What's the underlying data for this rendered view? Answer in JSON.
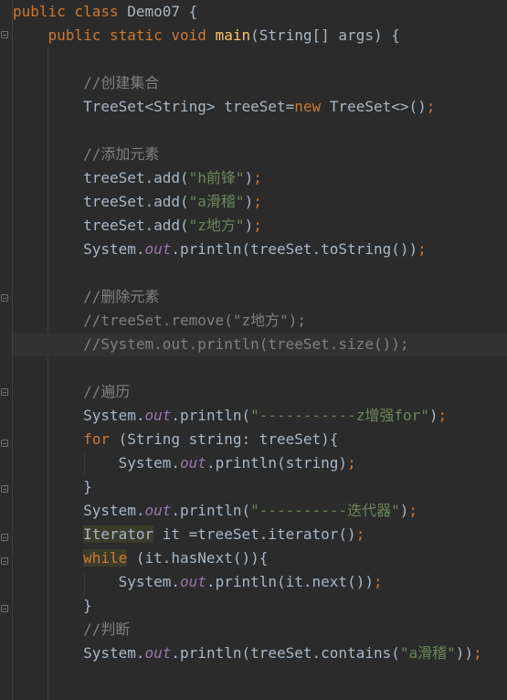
{
  "editor": {
    "line1": {
      "kw": "public class",
      "name": "Demo07",
      "brace": "{"
    },
    "line2": {
      "kw": "public static void",
      "fn": "main",
      "rest": "(String[] args) {"
    },
    "line4": "//创建集合",
    "line5": {
      "a": "TreeSet<String> treeSet=",
      "kw": "new",
      "b": " TreeSet<>()",
      "semi": ";"
    },
    "line7": "//添加元素",
    "line8": {
      "a": "treeSet.add(",
      "s": "\"h前锋\"",
      "b": ")",
      "semi": ";"
    },
    "line9": {
      "a": "treeSet.add(",
      "s": "\"a滑稽\"",
      "b": ")",
      "semi": ";"
    },
    "line10": {
      "a": "treeSet.add(",
      "s": "\"z地方\"",
      "b": ")",
      "semi": ";"
    },
    "line11": {
      "a": "System.",
      "st": "out",
      "b": ".println(treeSet.toString())",
      "semi": ";"
    },
    "line13": "//删除元素",
    "line14": "//treeSet.remove(\"z地方\");",
    "line15": "//System.out.println(treeSet.size());",
    "line17": "//遍历",
    "line18": {
      "a": "System.",
      "st": "out",
      "b": ".println(",
      "s": "\"-----------z增强for\"",
      "c": ")",
      "semi": ";"
    },
    "line19": {
      "kw": "for",
      "a": " (String string: treeSet){"
    },
    "line20": {
      "a": "System.",
      "st": "out",
      "b": ".println(string)",
      "semi": ";"
    },
    "line21": "}",
    "line22": {
      "a": "System.",
      "st": "out",
      "b": ".println(",
      "s": "\"----------迭代器\"",
      "c": ")",
      "semi": ";"
    },
    "line23": {
      "cls": "Iterator",
      "a": " it =treeSet.iterator()",
      "semi": ";"
    },
    "line24": {
      "kw": "while",
      "a": " (it.hasNext()){"
    },
    "line25": {
      "a": "System.",
      "st": "out",
      "b": ".println(it.next())",
      "semi": ";"
    },
    "line26": "}",
    "line27": "//判断",
    "line28": {
      "a": "System.",
      "st": "out",
      "b": ".println(treeSet.contains(",
      "s": "\"a滑稽\"",
      "c": "))",
      "semi": ";"
    }
  },
  "icons": {
    "bulb": "lightbulb-icon",
    "fold": "fold-marker-icon"
  }
}
